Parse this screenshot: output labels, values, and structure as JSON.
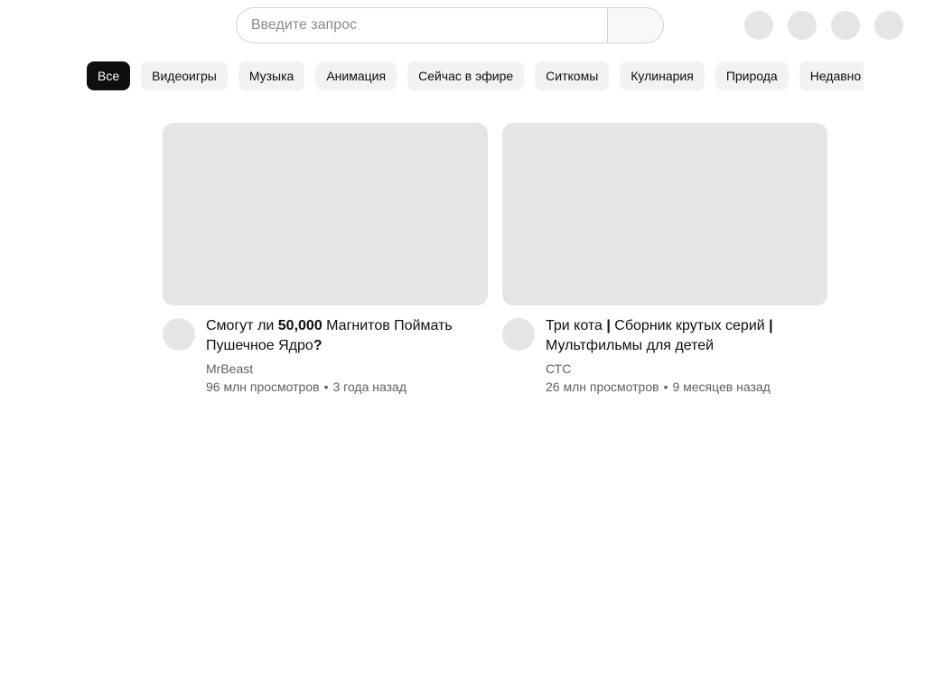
{
  "header": {
    "search_placeholder": "Введите запрос",
    "icons": [
      "search-icon",
      "mic-icon",
      "create-icon",
      "notifications-icon",
      "avatar"
    ]
  },
  "chips": [
    {
      "label": "Все",
      "active": true
    },
    {
      "label": "Видеоигры",
      "active": false
    },
    {
      "label": "Музыка",
      "active": false
    },
    {
      "label": "Анимация",
      "active": false
    },
    {
      "label": "Сейчас в эфире",
      "active": false
    },
    {
      "label": "Ситкомы",
      "active": false
    },
    {
      "label": "Кулинария",
      "active": false
    },
    {
      "label": "Природа",
      "active": false
    },
    {
      "label": "Недавно",
      "active": false
    }
  ],
  "videos": [
    {
      "title_parts": [
        "Смогут ли ",
        "50,000",
        " Магнитов Поймать Пушечное Ядро",
        "?"
      ],
      "channel": "MrBeast",
      "views": "96 млн просмотров",
      "separator": "•",
      "age": "3 года назад"
    },
    {
      "title_parts": [
        "Три кота ",
        "|",
        " Сборник крутых серий ",
        "|",
        " Мультфильмы для детей"
      ],
      "channel": "СТС",
      "views": "26 млн просмотров",
      "separator": "•",
      "age": "9 месяцев назад"
    }
  ],
  "colors": {
    "placeholder_gray": "#e5e5e5",
    "chip_bg": "#f2f2f2",
    "chip_active_bg": "#0f0f0f",
    "secondary_text": "#606060"
  }
}
